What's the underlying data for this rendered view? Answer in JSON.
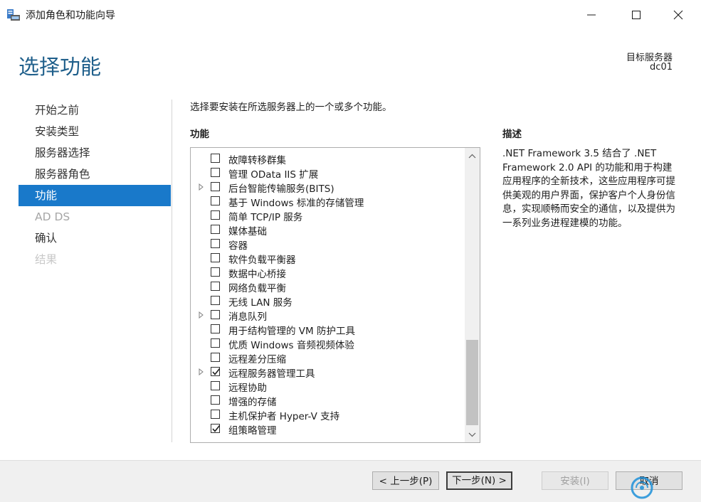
{
  "window": {
    "title": "添加角色和功能向导",
    "minimize_icon": "minimize-icon",
    "maximize_icon": "maximize-icon",
    "close_icon": "close-icon"
  },
  "header": {
    "title": "选择功能",
    "target_label": "目标服务器",
    "target_name": "dc01"
  },
  "nav": {
    "items": [
      {
        "label": "开始之前",
        "state": "normal"
      },
      {
        "label": "安装类型",
        "state": "normal"
      },
      {
        "label": "服务器选择",
        "state": "normal"
      },
      {
        "label": "服务器角色",
        "state": "normal"
      },
      {
        "label": "功能",
        "state": "active"
      },
      {
        "label": "AD DS",
        "state": "dim"
      },
      {
        "label": "确认",
        "state": "normal"
      },
      {
        "label": "结果",
        "state": "disabled"
      }
    ]
  },
  "content": {
    "instruction": "选择要安装在所选服务器上的一个或多个功能。",
    "features_heading": "功能",
    "features": [
      {
        "label": "故障转移群集",
        "checked": false,
        "expandable": false
      },
      {
        "label": "管理 OData IIS 扩展",
        "checked": false,
        "expandable": false
      },
      {
        "label": "后台智能传输服务(BITS)",
        "checked": false,
        "expandable": true
      },
      {
        "label": "基于 Windows 标准的存储管理",
        "checked": false,
        "expandable": false
      },
      {
        "label": "简单 TCP/IP 服务",
        "checked": false,
        "expandable": false
      },
      {
        "label": "媒体基础",
        "checked": false,
        "expandable": false
      },
      {
        "label": "容器",
        "checked": false,
        "expandable": false
      },
      {
        "label": "软件负载平衡器",
        "checked": false,
        "expandable": false
      },
      {
        "label": "数据中心桥接",
        "checked": false,
        "expandable": false
      },
      {
        "label": "网络负载平衡",
        "checked": false,
        "expandable": false
      },
      {
        "label": "无线 LAN 服务",
        "checked": false,
        "expandable": false
      },
      {
        "label": "消息队列",
        "checked": false,
        "expandable": true
      },
      {
        "label": "用于结构管理的 VM 防护工具",
        "checked": false,
        "expandable": false
      },
      {
        "label": "优质 Windows 音频视频体验",
        "checked": false,
        "expandable": false
      },
      {
        "label": "远程差分压缩",
        "checked": false,
        "expandable": false
      },
      {
        "label": "远程服务器管理工具",
        "checked": true,
        "expandable": true
      },
      {
        "label": "远程协助",
        "checked": false,
        "expandable": false
      },
      {
        "label": "增强的存储",
        "checked": false,
        "expandable": false
      },
      {
        "label": "主机保护者 Hyper-V 支持",
        "checked": false,
        "expandable": false
      },
      {
        "label": "组策略管理",
        "checked": true,
        "expandable": false
      }
    ],
    "description_heading": "描述",
    "description": ".NET Framework 3.5 结合了 .NET Framework 2.0 API 的功能和用于构建应用程序的全新技术，这些应用程序可提供美观的用户界面，保护客户个人身份信息，实现顺畅而安全的通信，以及提供为一系列业务进程建模的功能。"
  },
  "footer": {
    "prev_label": "< 上一步(P)",
    "next_label": "下一步(N) >",
    "install_label": "安装(I)",
    "cancel_label": "取消"
  },
  "colors": {
    "accent": "#1979ca",
    "header_title": "#1f5f8b"
  }
}
